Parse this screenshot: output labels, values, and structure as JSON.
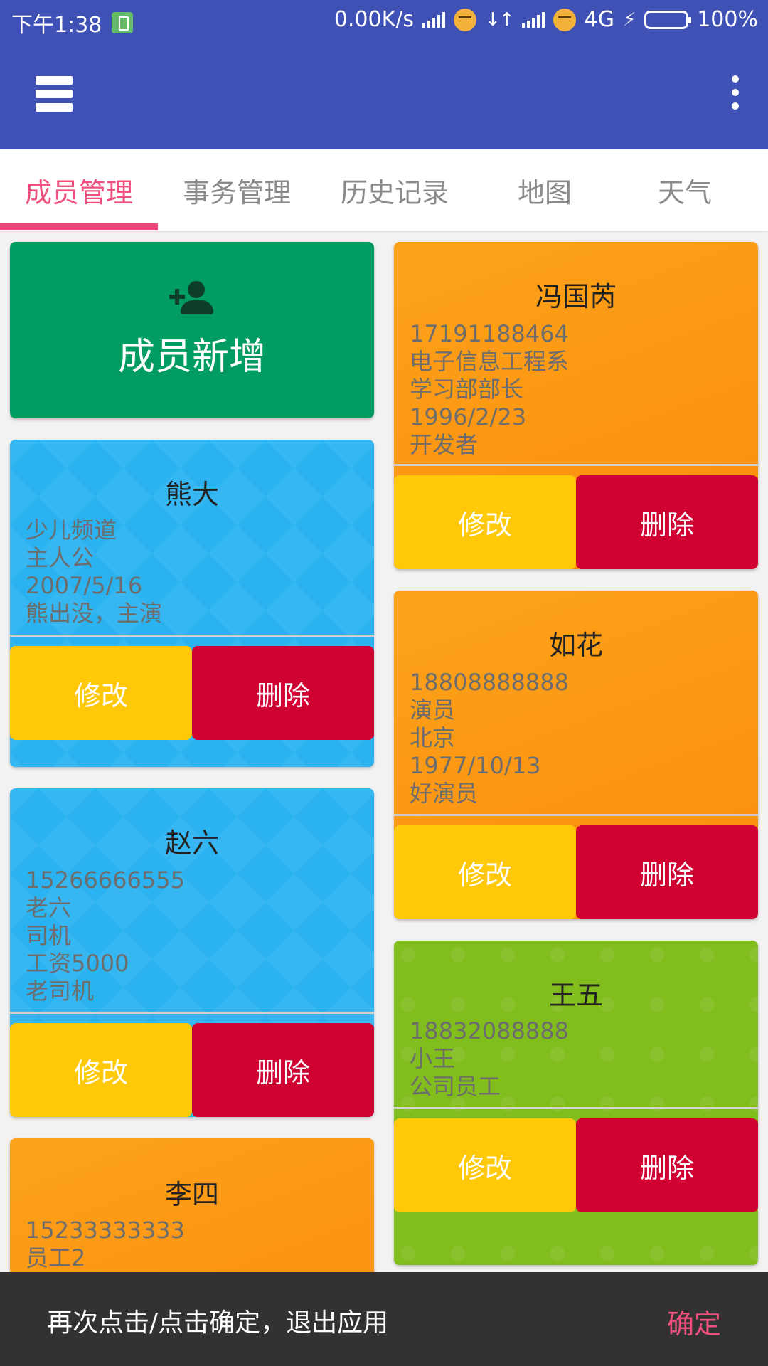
{
  "status_bar": {
    "time": "下午1:38",
    "speed": "0.00K/s",
    "network": "4G",
    "battery": "100%",
    "colors": {
      "background": "#3f51b5",
      "battery_fill": "#56e04a"
    }
  },
  "app_bar": {
    "background": "#3f51b5"
  },
  "tabs": [
    {
      "label": "成员管理",
      "active": true
    },
    {
      "label": "事务管理",
      "active": false
    },
    {
      "label": "历史记录",
      "active": false
    },
    {
      "label": "地图",
      "active": false
    },
    {
      "label": "天气",
      "active": false
    }
  ],
  "add_member": {
    "label": "成员新增",
    "icon": "person-add-icon"
  },
  "cards": {
    "xiongda": {
      "name": "熊大",
      "lines": [
        "少儿频道",
        "主人公",
        "2007/5/16",
        "熊出没，主演"
      ],
      "edit": "修改",
      "delete": "删除"
    },
    "zhaoliu": {
      "name": "赵六",
      "lines": [
        "15266666555",
        "老六",
        "司机",
        "工资5000",
        "老司机"
      ],
      "edit": "修改",
      "delete": "删除"
    },
    "lisi": {
      "name": "李四",
      "lines": [
        "15233333333",
        "员工2"
      ]
    },
    "fengguoru": {
      "name": "冯国芮",
      "lines": [
        "17191188464",
        "电子信息工程系",
        "学习部部长",
        "1996/2/23",
        "开发者"
      ],
      "edit": "修改",
      "delete": "删除"
    },
    "ruhua": {
      "name": "如花",
      "lines": [
        "18808888888",
        "演员",
        "北京",
        "1977/10/13",
        "好演员"
      ],
      "edit": "修改",
      "delete": "删除"
    },
    "wangwu": {
      "name": "王五",
      "lines": [
        "18832088888",
        "小王",
        "公司员工"
      ],
      "edit": "修改",
      "delete": "删除"
    }
  },
  "colors": {
    "accent": "#f0457a",
    "edit_button": "#ffc90a",
    "delete_button": "#cf0232",
    "add_card": "#019c61"
  },
  "snackbar": {
    "message": "再次点击/点击确定，退出应用",
    "action": "确定"
  }
}
